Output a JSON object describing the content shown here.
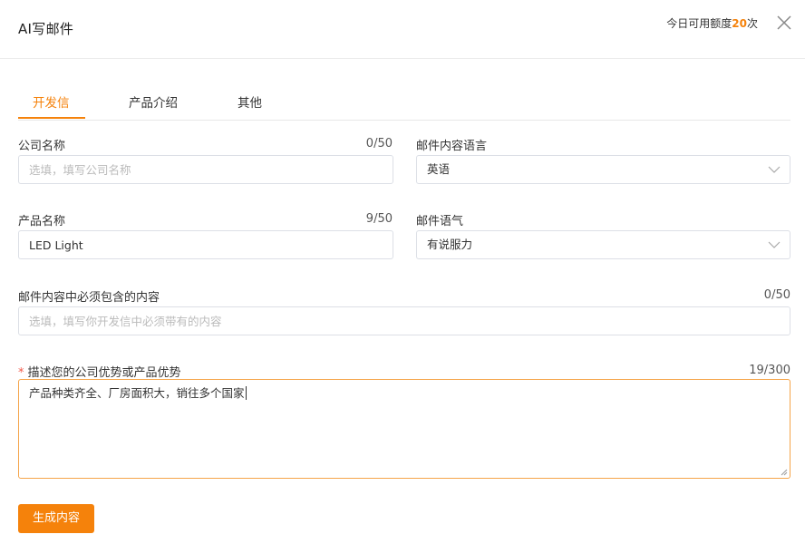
{
  "header": {
    "title": "AI写邮件",
    "quota_prefix": "今日可用额度",
    "quota_value": "20",
    "quota_suffix": "次"
  },
  "tabs": [
    {
      "label": "开发信",
      "active": true
    },
    {
      "label": "产品介绍",
      "active": false
    },
    {
      "label": "其他",
      "active": false
    }
  ],
  "form": {
    "company": {
      "label": "公司名称",
      "count": "0/50",
      "placeholder": "选填，填写公司名称",
      "value": ""
    },
    "language": {
      "label": "邮件内容语言",
      "value": "英语"
    },
    "product": {
      "label": "产品名称",
      "count": "9/50",
      "value": "LED Light"
    },
    "tone": {
      "label": "邮件语气",
      "value": "有说服力"
    },
    "must_include": {
      "label": "邮件内容中必须包含的内容",
      "count": "0/50",
      "placeholder": "选填，填写你开发信中必须带有的内容",
      "value": ""
    },
    "advantage": {
      "required_mark": "*",
      "label": "描述您的公司优势或产品优势",
      "count": "19/300",
      "value": "产品种类齐全、厂房面积大，销往多个国家"
    }
  },
  "generate_button": "生成内容",
  "colors": {
    "accent": "#f5820b",
    "required": "#f25a4a"
  }
}
